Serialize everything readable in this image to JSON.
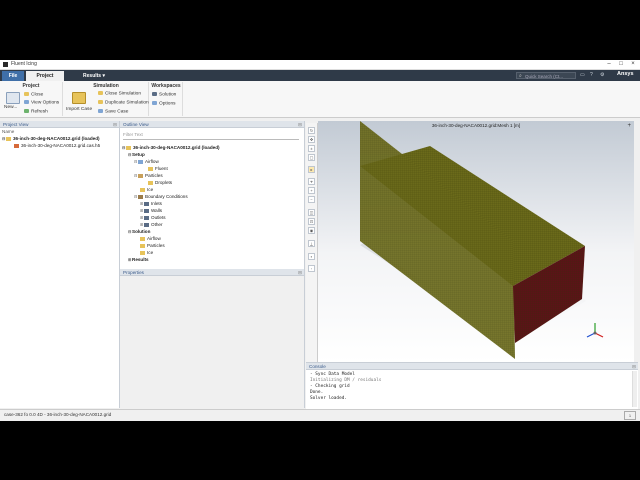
{
  "window": {
    "title": "Fluent Icing"
  },
  "tabs": {
    "file": "File",
    "project": "Project",
    "results": "Results"
  },
  "search": {
    "placeholder": "Quick Search (Ct..."
  },
  "brand": "Ansys",
  "ribbon": {
    "project": {
      "title": "Project",
      "close": "Close",
      "view_options": "View Options",
      "refresh": "Refresh",
      "new": "New..."
    },
    "simulation": {
      "title": "Simulation",
      "import_case": "Import Case",
      "close_simulation": "Close Simulation",
      "duplicate_simulation": "Duplicate Simulation",
      "save_case": "Save Case"
    },
    "workspaces": {
      "title": "Workspaces",
      "solution": "Solution",
      "options": "Options"
    }
  },
  "project_view": {
    "title": "Project View",
    "column": "Name",
    "items": [
      "36-inch-30-deg-NACA0012.grid (loaded)",
      "36-inch-30-deg-NACA0012.grid.cas.h5"
    ]
  },
  "outline_view": {
    "title": "Outline View",
    "filter_placeholder": "Filter Text",
    "root": "36-inch-30-deg-NACA0012.grid (loaded)",
    "setup": "Setup",
    "airflow": "Airflow",
    "fluent": "Fluent",
    "particles": "Particles",
    "droplets": "Droplets",
    "ice": "Ice",
    "boundary_conditions": "Boundary Conditions",
    "inlets": "Inlets",
    "walls": "Walls",
    "outlets": "Outlets",
    "other": "Other",
    "solution": "Solution",
    "sol_airflow": "Airflow",
    "sol_particles": "Particles",
    "sol_ice": "Ice",
    "results": "Results"
  },
  "properties": {
    "title": "Properties"
  },
  "viewport": {
    "title": "36-inch-30-deg-NACA0012.grid:Mesh 1 [m]"
  },
  "console": {
    "title": "Console",
    "lines": [
      "- Sync Data Model",
      "  Initializing DM / residuals",
      "- Checking grid",
      "Done.",
      "Solver loaded."
    ]
  },
  "status": {
    "text": "case-362 fo 0.0 4D - 36-inch-30-deg-NACA0012.grid"
  },
  "colors": {
    "tabbar": "#2f3a48",
    "mesh": "#6b6a1a",
    "mesh_dark": "#7a1a22"
  }
}
